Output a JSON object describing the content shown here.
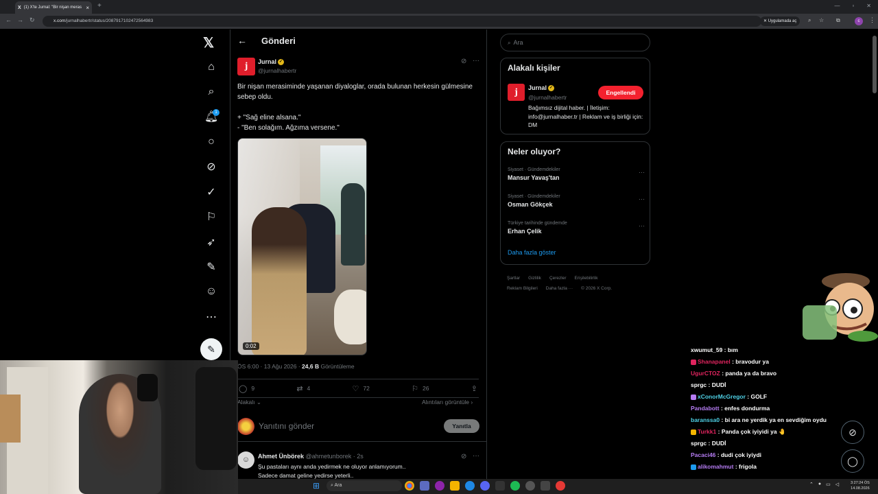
{
  "browser": {
    "tab_title": "(1) X'te Jurnal: \"Bir nişan meras",
    "url_host": "x.com",
    "url_path": "/jurnalhabertr/status/2087917102472564983",
    "open_in_app": "Uygulamada aç"
  },
  "nav": {
    "logo": "𝕏",
    "notif_count": "1"
  },
  "header": {
    "title": "Gönderi"
  },
  "tweet": {
    "author_name": "Jurnal",
    "author_handle": "@jurnalhabertr",
    "text_line1": "Bir nişan merasiminde yaşanan diyaloglar, orada bulunan herkesin gülmesine sebep oldu.",
    "text_line2": "+ \"Sağ eline alsana.\"",
    "text_line3": "- \"Ben solağım. Ağzıma versene.\"",
    "video_duration": "0:02",
    "time_date": "ÖS 6:00 · 13 Ağu 2026 · ",
    "views_count": "24,6 B",
    "views_label": " Görüntüleme",
    "replies": "9",
    "reposts": "4",
    "likes": "72",
    "bookmarks": "26",
    "related_label": "Alakalı",
    "quotes_label": "Alıntıları görüntüle"
  },
  "reply": {
    "placeholder": "Yanıtını gönder",
    "button": "Yanıtla"
  },
  "comment": {
    "name": "Ahmet Ünbörek",
    "handle": "@ahmetunborek · 2s",
    "line1": "Şu pastaları aynı anda yedirmek ne oluyor anlamıyorum..",
    "line2": "Sadece damat geline yedirse yeterli.."
  },
  "sidebar": {
    "search_placeholder": "Ara",
    "related_title": "Alakalı kişiler",
    "related_name": "Jurnal",
    "related_handle": "@jurnalhabertr",
    "blocked_label": "Engellendi",
    "related_bio": "Bağımsız dijital haber. | İletişim: info@jurnalhaber.tr | Reklam ve iş birliği için: DM",
    "trends_title": "Neler oluyor?",
    "trends": [
      {
        "category": "Siyaset · Gündemdekiler",
        "name": "Mansur Yavaş'tan"
      },
      {
        "category": "Siyaset · Gündemdekiler",
        "name": "Osman Gökçek"
      },
      {
        "category": "Türkiye tarihinde gündemde",
        "name": "Erhan Çelik"
      }
    ],
    "show_more": "Daha fazla göster",
    "footer": [
      "Şartlar",
      "Gizlilik",
      "Çerezler",
      "Erişilebilirlik",
      "Reklam Bilgileri",
      "Daha fazla ···",
      "© 2026 X Corp."
    ]
  },
  "chat": [
    {
      "user": "xwumut_59",
      "msg": ": bım",
      "color": "#ffffff"
    },
    {
      "user": "Shanapanel",
      "msg": ": bravodur ya",
      "color": "#e0245e"
    },
    {
      "user": "UgurCTOZ",
      "msg": ": panda ya da bravo",
      "color": "#e0245e"
    },
    {
      "user": "sprgc",
      "msg": ": DUDİ",
      "color": "#ffffff"
    },
    {
      "user": "xConorMcGregor",
      "msg": ": GOLF",
      "color": "#4fd1e6"
    },
    {
      "user": "Pandabott",
      "msg": ": enfes dondurma",
      "color": "#b57cf2"
    },
    {
      "user": "baranssa0",
      "msg": ": bi ara ne yerdik ya en sevdiğim oydu",
      "color": "#4fd1e6"
    },
    {
      "user": "Turkk1",
      "msg": ": Panda çok iyiyidi ya 🤚",
      "color": "#e0245e"
    },
    {
      "user": "sprgc",
      "msg": ": DUDİ",
      "color": "#ffffff"
    },
    {
      "user": "Pacaci46",
      "msg": ": dudi çok iyiydi",
      "color": "#b57cf2"
    },
    {
      "user": "alikomahmut",
      "msg": ": frigola",
      "color": "#b57cf2"
    }
  ],
  "taskbar": {
    "search": "Ara",
    "time": "3:27:24 ÖS",
    "date": "14.08.2026"
  }
}
